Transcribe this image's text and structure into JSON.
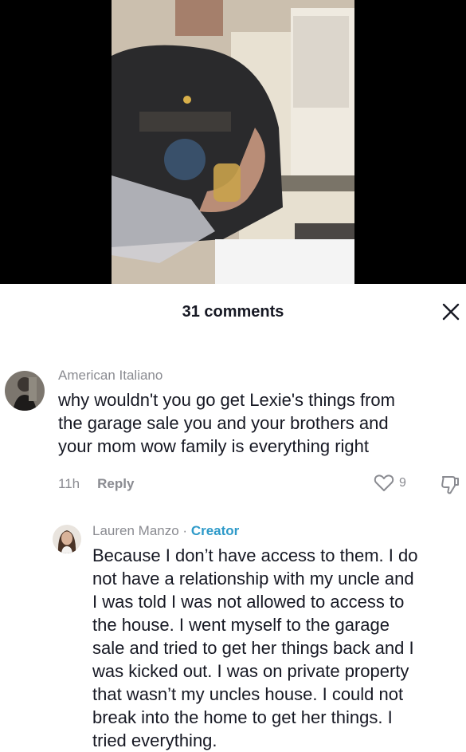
{
  "header": {
    "comments_count": "31 comments"
  },
  "icons": {
    "close": "close-icon",
    "like": "heart-outline-icon",
    "dislike": "thumbs-down-icon"
  },
  "comments": [
    {
      "username": "American Italiano",
      "text_lines": [
        "why wouldn't you go get Lexie's things from",
        "the garage sale you and your brothers and",
        "your mom wow family is everything right"
      ],
      "time": "11h",
      "reply_label": "Reply",
      "likes": "9"
    },
    {
      "username": "Lauren Manzo",
      "separator": "·",
      "badge": "Creator",
      "text_lines": [
        "Because I don’t have access to them. I do",
        "not have a relationship with my uncle and",
        "I was told I was not allowed to access to",
        "the house. I went myself to the garage",
        "sale and tried to get her things back and I",
        "was kicked out. I was on private property",
        "that wasn’t my uncles house. I could not",
        "break into the home to get her things. I",
        "tried everything."
      ]
    }
  ],
  "colors": {
    "accent_creator": "#2e9ac9",
    "muted_text": "#8a8b91",
    "primary_text": "#161823",
    "video_bg": "#000000"
  }
}
